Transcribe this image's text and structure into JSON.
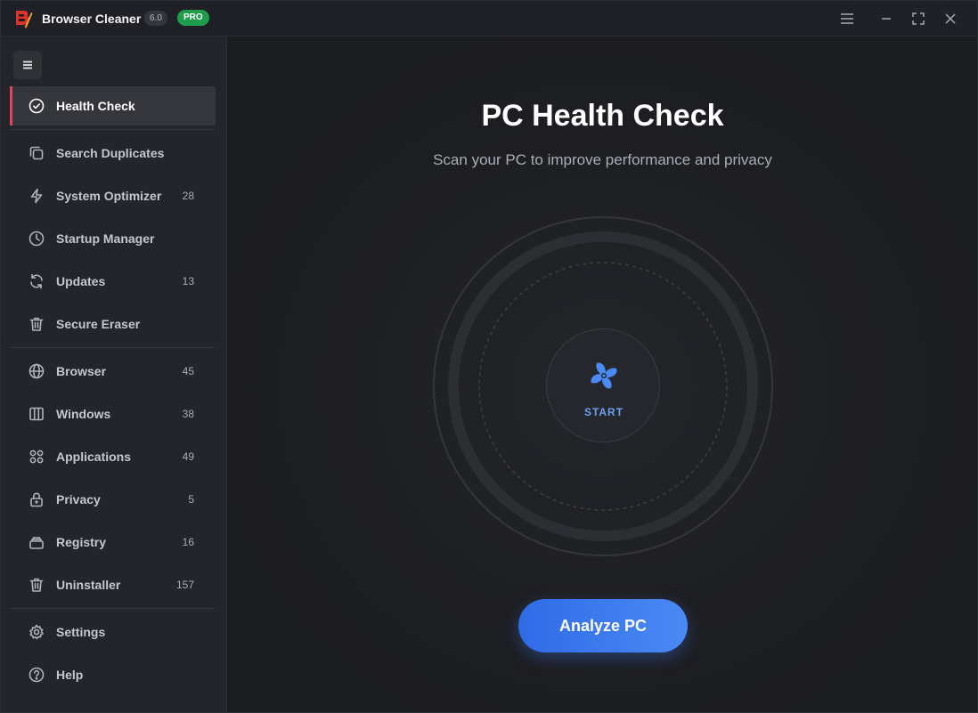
{
  "app": {
    "title": "Browser Cleaner",
    "version": "6.0",
    "edition": "PRO",
    "logo": "browser-cleaner-logo-icon",
    "accent_color": "#e0455a",
    "brand_color": "#d9342b"
  },
  "titlebar": {
    "buttons": [
      "hamburger-menu-icon",
      "minimize-icon",
      "maximize-icon",
      "close-icon"
    ]
  },
  "sidebar": {
    "toggle_icon": "menu-toggle-icon",
    "items": [
      {
        "label": "Health Check",
        "count": "",
        "icon": "check-circle-icon",
        "active": true
      },
      {
        "label": "Search Duplicates",
        "count": "",
        "icon": "copy-icon"
      },
      {
        "label": "System Optimizer",
        "count": "28",
        "icon": "lightning-icon"
      },
      {
        "label": "Startup Manager",
        "count": "",
        "icon": "clock-icon"
      },
      {
        "label": "Updates",
        "count": "13",
        "icon": "refresh-icon"
      },
      {
        "label": "Secure Eraser",
        "count": "",
        "icon": "trash-icon"
      },
      {
        "label": "Browser",
        "count": "45",
        "icon": "globe-icon"
      },
      {
        "label": "Windows",
        "count": "38",
        "icon": "columns-icon"
      },
      {
        "label": "Applications",
        "count": "49",
        "icon": "grid-icon"
      },
      {
        "label": "Privacy",
        "count": "5",
        "icon": "lock-icon"
      },
      {
        "label": "Registry",
        "count": "16",
        "icon": "layers-icon"
      },
      {
        "label": "Uninstaller",
        "count": "157",
        "icon": "trash-icon"
      },
      {
        "label": "Settings",
        "count": "",
        "icon": "gear-icon"
      },
      {
        "label": "Help",
        "count": "",
        "icon": "help-circle-icon"
      }
    ]
  },
  "main": {
    "title": "PC Health Check",
    "subtitle": "Scan your PC to improve performance and privacy",
    "start_label": "START",
    "start_icon": "fan-icon",
    "analyze_button": "Analyze PC",
    "primary_color": "#3b7cf0"
  }
}
